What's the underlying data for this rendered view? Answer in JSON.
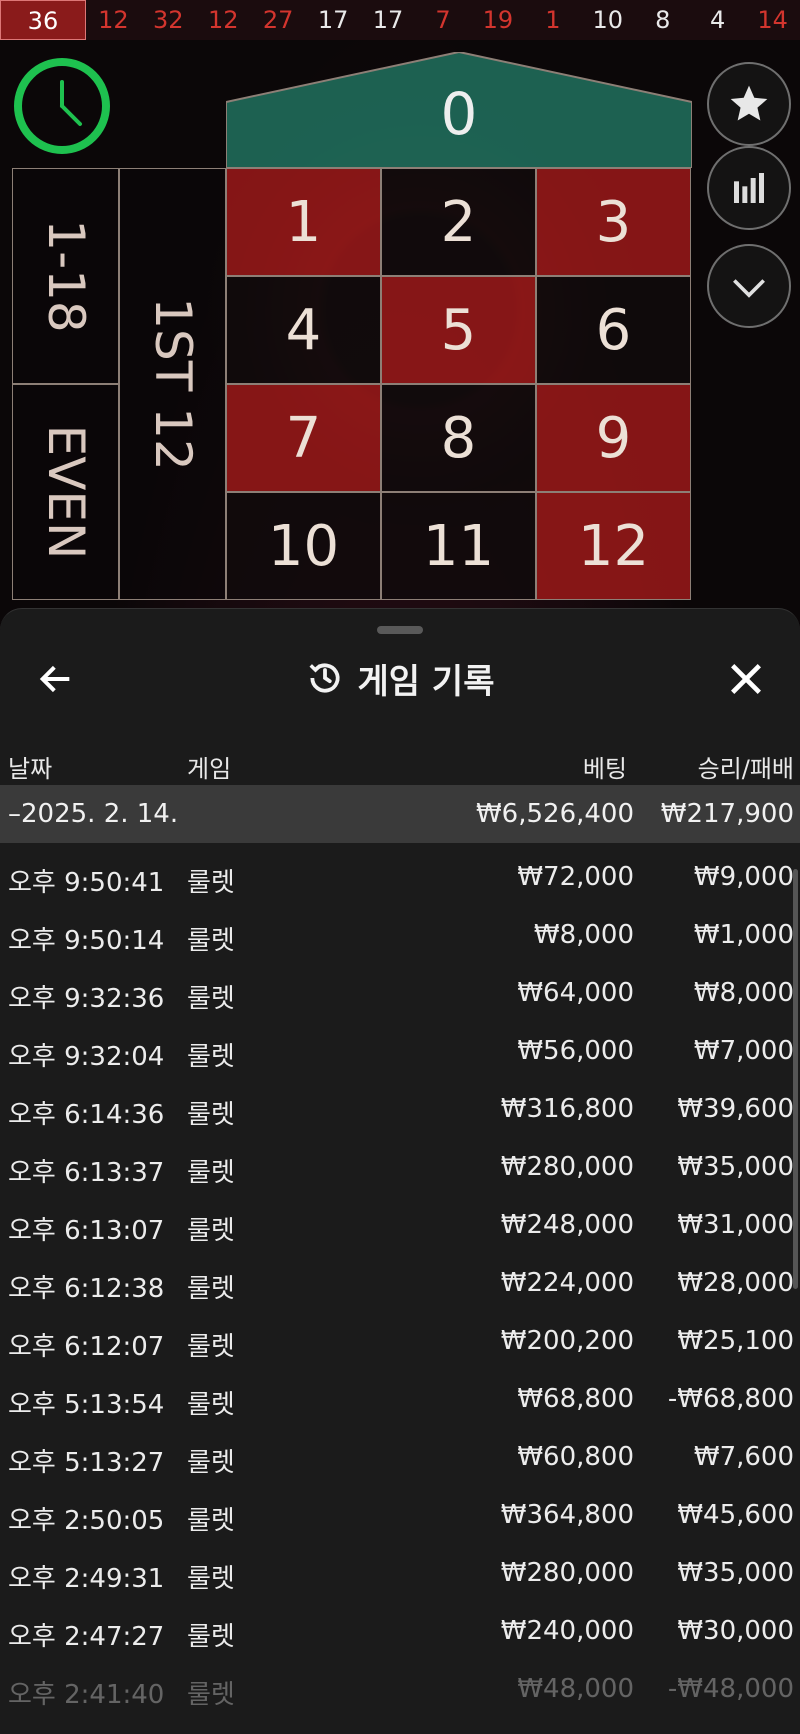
{
  "results_strip": [
    {
      "n": "36",
      "c": "red"
    },
    {
      "n": "12",
      "c": "red"
    },
    {
      "n": "32",
      "c": "red"
    },
    {
      "n": "12",
      "c": "red"
    },
    {
      "n": "27",
      "c": "red"
    },
    {
      "n": "17",
      "c": "blk"
    },
    {
      "n": "17",
      "c": "blk"
    },
    {
      "n": "7",
      "c": "red"
    },
    {
      "n": "19",
      "c": "red"
    },
    {
      "n": "1",
      "c": "red"
    },
    {
      "n": "10",
      "c": "blk"
    },
    {
      "n": "8",
      "c": "blk"
    },
    {
      "n": "4",
      "c": "blk"
    },
    {
      "n": "14",
      "c": "red"
    }
  ],
  "table": {
    "zero": "0",
    "cells": [
      {
        "n": "1",
        "c": "r"
      },
      {
        "n": "2",
        "c": "b"
      },
      {
        "n": "3",
        "c": "r"
      },
      {
        "n": "4",
        "c": "b"
      },
      {
        "n": "5",
        "c": "r"
      },
      {
        "n": "6",
        "c": "b"
      },
      {
        "n": "7",
        "c": "r"
      },
      {
        "n": "8",
        "c": "b"
      },
      {
        "n": "9",
        "c": "r"
      },
      {
        "n": "10",
        "c": "b"
      },
      {
        "n": "11",
        "c": "b"
      },
      {
        "n": "12",
        "c": "r"
      }
    ],
    "low_label": "1-18",
    "even_label": "EVEN",
    "dozen_label": "1ST 12"
  },
  "icons": {
    "timer": "clock-icon",
    "favorite": "star-icon",
    "stats": "bar-chart-icon",
    "collapse": "chevron-down-icon",
    "back": "arrow-left-icon",
    "history": "history-icon",
    "close": "close-icon"
  },
  "colors": {
    "red": "#d3352e",
    "timer": "#1ec14f",
    "zero": "#1f6b5a"
  },
  "sheet": {
    "title": "게임 기록",
    "headers": {
      "date": "날짜",
      "game": "게임",
      "bet": "베팅",
      "win": "승리/패배"
    },
    "date_group": {
      "label": "–2025. 2. 14.",
      "bet": "₩6,526,400",
      "win": "₩217,900"
    },
    "rows": [
      {
        "time": "오후 9:50:41",
        "game": "룰렛",
        "bet": "₩72,000",
        "win": "₩9,000"
      },
      {
        "time": "오후 9:50:14",
        "game": "룰렛",
        "bet": "₩8,000",
        "win": "₩1,000"
      },
      {
        "time": "오후 9:32:36",
        "game": "룰렛",
        "bet": "₩64,000",
        "win": "₩8,000"
      },
      {
        "time": "오후 9:32:04",
        "game": "룰렛",
        "bet": "₩56,000",
        "win": "₩7,000"
      },
      {
        "time": "오후 6:14:36",
        "game": "룰렛",
        "bet": "₩316,800",
        "win": "₩39,600"
      },
      {
        "time": "오후 6:13:37",
        "game": "룰렛",
        "bet": "₩280,000",
        "win": "₩35,000"
      },
      {
        "time": "오후 6:13:07",
        "game": "룰렛",
        "bet": "₩248,000",
        "win": "₩31,000"
      },
      {
        "time": "오후 6:12:38",
        "game": "룰렛",
        "bet": "₩224,000",
        "win": "₩28,000"
      },
      {
        "time": "오후 6:12:07",
        "game": "룰렛",
        "bet": "₩200,200",
        "win": "₩25,100"
      },
      {
        "time": "오후 5:13:54",
        "game": "룰렛",
        "bet": "₩68,800",
        "win": "-₩68,800"
      },
      {
        "time": "오후 5:13:27",
        "game": "룰렛",
        "bet": "₩60,800",
        "win": "₩7,600"
      },
      {
        "time": "오후 2:50:05",
        "game": "룰렛",
        "bet": "₩364,800",
        "win": "₩45,600"
      },
      {
        "time": "오후 2:49:31",
        "game": "룰렛",
        "bet": "₩280,000",
        "win": "₩35,000"
      },
      {
        "time": "오후 2:47:27",
        "game": "룰렛",
        "bet": "₩240,000",
        "win": "₩30,000"
      },
      {
        "time": "오후 2:41:40",
        "game": "룰렛",
        "bet": "₩48,000",
        "win": "-₩48,000"
      }
    ]
  }
}
